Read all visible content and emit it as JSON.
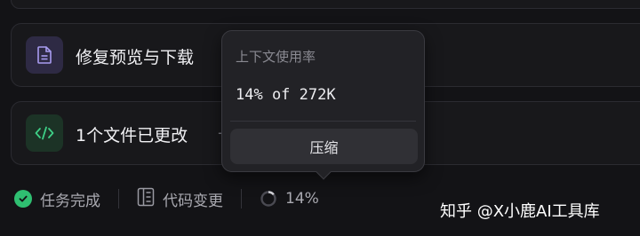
{
  "cards": [
    {
      "title": "修复预览与下载 ",
      "icon": "document-icon"
    },
    {
      "title": "1个文件已更改",
      "dash": "-",
      "icon": "code-icon"
    }
  ],
  "popover": {
    "title": "上下文使用率",
    "usage": "14% of 272K",
    "compress_label": "压缩"
  },
  "status": {
    "task_label": "任务完成",
    "code_changes_label": "代码变更",
    "context_percent": "14%",
    "context_fraction": 0.14
  },
  "watermark": "知乎 @X小鹿AI工具库",
  "colors": {
    "success": "#2fbf71",
    "code_green": "#3ecf86",
    "doc_purple": "#a89cf0"
  }
}
